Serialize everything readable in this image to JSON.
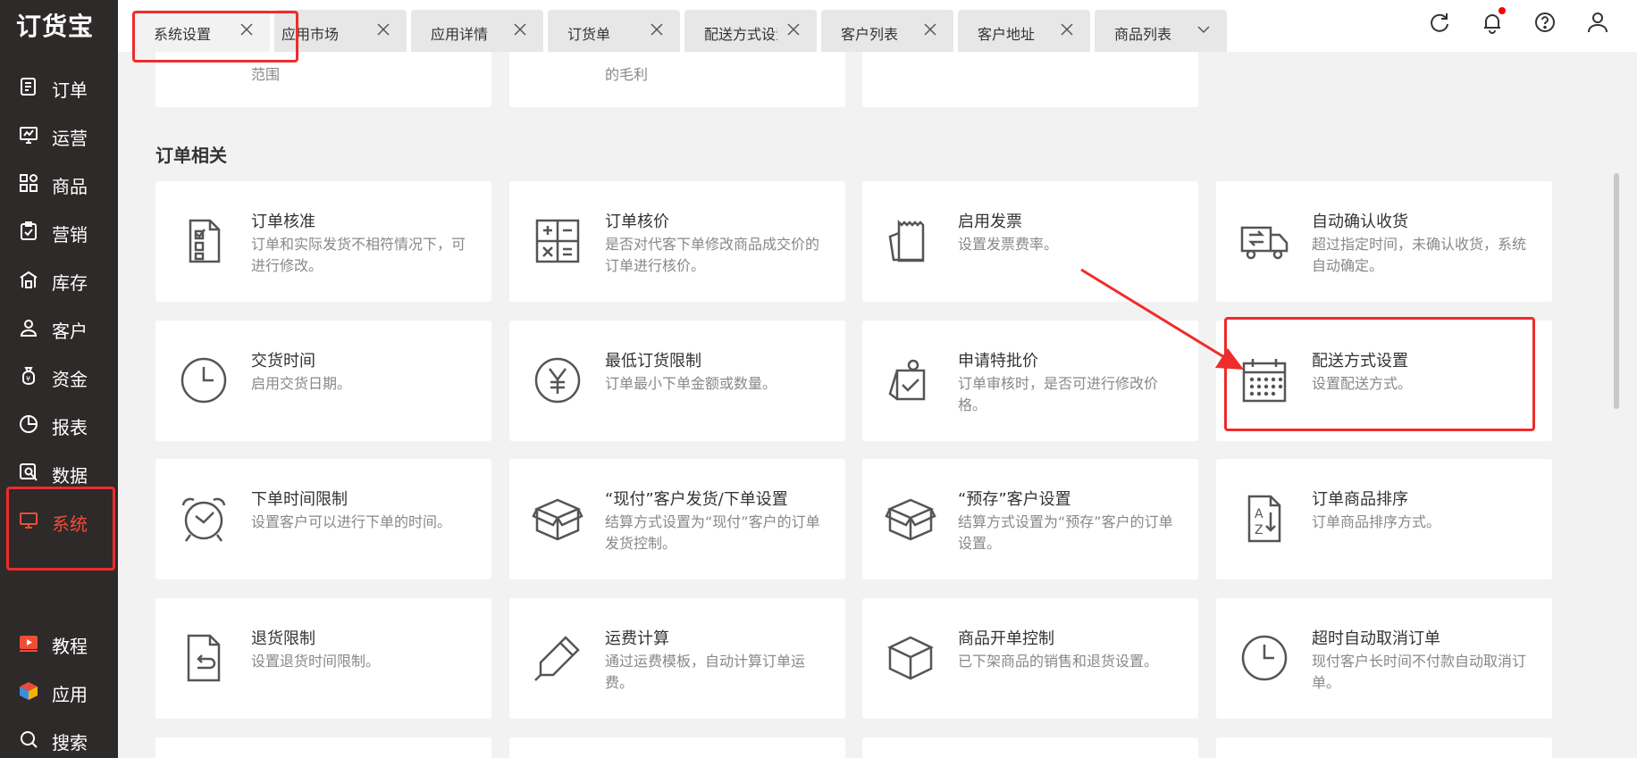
{
  "app": {
    "logo": "订货宝"
  },
  "sidebar": {
    "items": [
      {
        "label": "订单",
        "icon": "order-doc-icon"
      },
      {
        "label": "运营",
        "icon": "chart-board-icon"
      },
      {
        "label": "商品",
        "icon": "grid-icon"
      },
      {
        "label": "营销",
        "icon": "clipboard-check-icon"
      },
      {
        "label": "库存",
        "icon": "warehouse-icon"
      },
      {
        "label": "客户",
        "icon": "user-icon"
      },
      {
        "label": "资金",
        "icon": "money-bag-icon"
      },
      {
        "label": "报表",
        "icon": "pie-icon"
      },
      {
        "label": "数据",
        "icon": "data-search-icon"
      },
      {
        "label": "系统",
        "icon": "monitor-icon",
        "active": true
      },
      {
        "label": "教程",
        "icon": "play-icon"
      },
      {
        "label": "应用",
        "icon": "cube-icon"
      },
      {
        "label": "搜索",
        "icon": "search-icon"
      }
    ]
  },
  "tabs": [
    {
      "label": "系统设置",
      "active": true
    },
    {
      "label": "应用市场"
    },
    {
      "label": "应用详情"
    },
    {
      "label": "订货单"
    },
    {
      "label": "配送方式设置"
    },
    {
      "label": "客户列表"
    },
    {
      "label": "客户地址"
    },
    {
      "label": "商品列表"
    }
  ],
  "top_partial": [
    "范围",
    "的毛利"
  ],
  "section": {
    "title": "订单相关"
  },
  "cards": [
    {
      "title": "订单核准",
      "desc": "订单和实际发货不相符情况下，可进行修改。",
      "icon": "checklist-doc-icon"
    },
    {
      "title": "订单核价",
      "desc": "是否对代客下单修改商品成交价的订单进行核价。",
      "icon": "calculator-icon"
    },
    {
      "title": "启用发票",
      "desc": "设置发票费率。",
      "icon": "invoice-icon"
    },
    {
      "title": "自动确认收货",
      "desc": "超过指定时间，未确认收货，系统自动确定。",
      "icon": "truck-icon"
    },
    {
      "title": "交货时间",
      "desc": "启用交货日期。",
      "icon": "clock-icon"
    },
    {
      "title": "最低订货限制",
      "desc": "订单最小下单金额或数量。",
      "icon": "yen-icon"
    },
    {
      "title": "申请特批价",
      "desc": "订单审核时，是否可进行修改价格。",
      "icon": "approval-icon"
    },
    {
      "title": "配送方式设置",
      "desc": "设置配送方式。",
      "icon": "calendar-icon"
    },
    {
      "title": "下单时间限制",
      "desc": "设置客户可以进行下单的时间。",
      "icon": "alarm-clock-icon"
    },
    {
      "title": "“现付”客户发货/下单设置",
      "desc": "结算方式设置为“现付”客户的订单发货控制。",
      "icon": "open-box-icon"
    },
    {
      "title": "“预存”客户设置",
      "desc": "结算方式设置为“预存”客户的订单设置。",
      "icon": "open-box-icon"
    },
    {
      "title": "订单商品排序",
      "desc": "订单商品排序方式。",
      "icon": "sort-az-icon"
    },
    {
      "title": "退货限制",
      "desc": "设置退货时间限制。",
      "icon": "return-doc-icon"
    },
    {
      "title": "运费计算",
      "desc": "通过运费模板，自动计算订单运费。",
      "icon": "pen-icon"
    },
    {
      "title": "商品开单控制",
      "desc": "已下架商品的销售和退货设置。",
      "icon": "box-icon"
    },
    {
      "title": "超时自动取消订单",
      "desc": "现付客户长时间不付款自动取消订单。",
      "icon": "clock-icon"
    }
  ],
  "colors": {
    "sidebar_bg": "#2d2a29",
    "active": "#f04d36",
    "highlight": "#ee2c2c"
  }
}
